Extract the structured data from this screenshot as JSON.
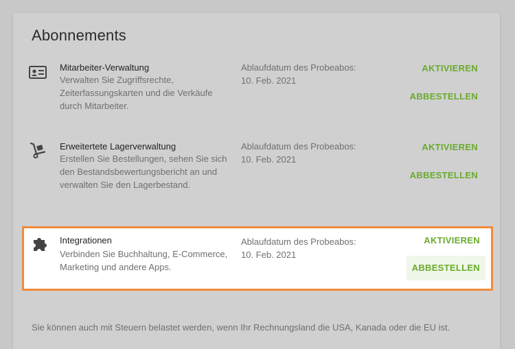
{
  "card": {
    "title": "Abonnements"
  },
  "subscriptions": [
    {
      "icon": "id-card-icon",
      "name": "Mitarbeiter-Verwaltung",
      "description": "Verwalten Sie Zugriffsrechte, Zeiterfassungskarten und die Verkäufe durch Mitarbeiter.",
      "expiry": "Ablaufdatum des Probeabos: 10. Feb. 2021",
      "activate_label": "AKTIVIEREN",
      "cancel_label": "ABBESTELLEN"
    },
    {
      "icon": "hand-truck-icon",
      "name": "Erweitertete Lagerverwaltung",
      "description": "Erstellen Sie Bestellungen, sehen Sie sich den Bestandsbewertungsbericht an und verwalten Sie den Lagerbestand.",
      "expiry": "Ablaufdatum des Probeabos: 10. Feb. 2021",
      "activate_label": "AKTIVIEREN",
      "cancel_label": "ABBESTELLEN"
    },
    {
      "icon": "puzzle-icon",
      "name": "Integrationen",
      "description": "Verbinden Sie Buchhaltung, E-Commerce, Marketing und andere Apps.",
      "expiry": "Ablaufdatum des Probeabos: 10. Feb. 2021",
      "activate_label": "AKTIVIEREN",
      "cancel_label": "ABBESTELLEN"
    }
  ],
  "footer": {
    "note": "Sie können auch mit Steuern belastet werden, wenn Ihr Rechnungsland die USA, Kanada oder die EU ist."
  },
  "colors": {
    "accent": "#6aaa2e",
    "highlight_border": "#f08a3c"
  }
}
